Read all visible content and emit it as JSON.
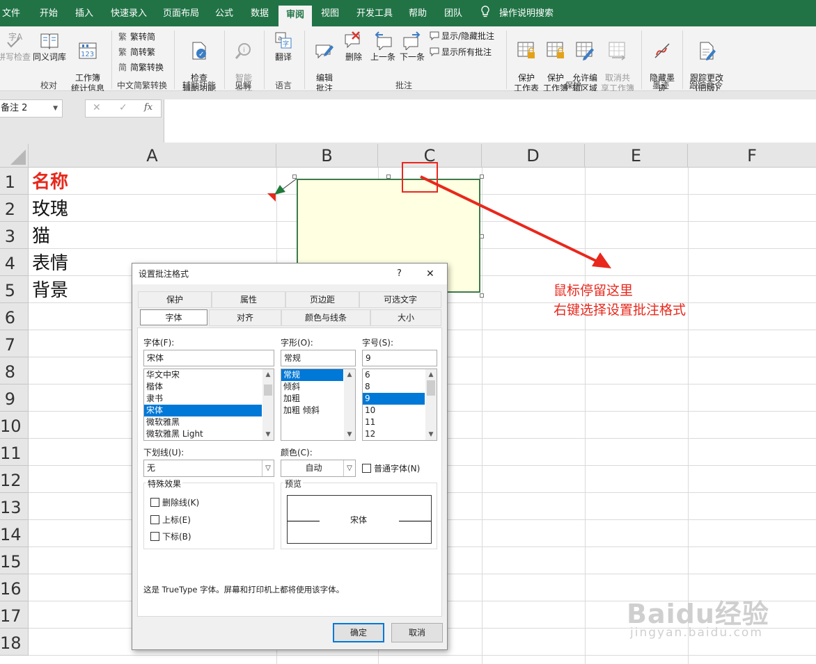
{
  "ribbon": {
    "tabs": [
      "文件",
      "开始",
      "插入",
      "快速录入",
      "页面布局",
      "公式",
      "数据",
      "审阅",
      "视图",
      "开发工具",
      "帮助",
      "团队",
      "操作说明搜索"
    ],
    "active_tab": "审阅",
    "proof": {
      "spell": "拼写检查",
      "thesaurus": "同义词库",
      "stats": "工作簿\n统计信息",
      "label": "校对"
    },
    "chinese": {
      "to_simp": "繁转简",
      "to_trad": "简转繁",
      "convert": "简繁转换",
      "label": "中文简繁转换"
    },
    "access": {
      "check": "检查\n辅助功能",
      "label": "辅助功能"
    },
    "insights": {
      "smart": "智能\n查找",
      "label": "见解"
    },
    "language": {
      "translate": "翻译",
      "label": "语言"
    },
    "comments": {
      "edit": "编辑\n批注",
      "delete": "删除",
      "prev": "上一条",
      "next": "下一条",
      "show_hide": "显示/隐藏批注",
      "show_all": "显示所有批注",
      "label": "批注"
    },
    "protect": {
      "sheet": "保护\n工作表",
      "book": "保护\n工作簿",
      "allow": "允许编\n辑区域",
      "unshare": "取消共\n享工作簿",
      "label": "保护"
    },
    "ink": {
      "hide": "隐藏墨\n迹",
      "label": "墨迹"
    },
    "track": {
      "track": "跟踪更改\n(旧版)",
      "label": "跟踪命令"
    }
  },
  "formula_bar": {
    "name_box": "备注 2",
    "cancel": "✕",
    "enter": "✓",
    "fx": "fx",
    "value": ""
  },
  "sheet": {
    "columns": [
      "A",
      "B",
      "C",
      "D",
      "E",
      "F"
    ],
    "rows": [
      "1",
      "2",
      "3",
      "4",
      "5",
      "6",
      "7",
      "8",
      "9",
      "10",
      "11",
      "12",
      "13",
      "14",
      "15",
      "16",
      "17",
      "18"
    ],
    "cells": {
      "a1": "名称",
      "a2": "玫瑰",
      "a3": "猫",
      "a4": "表情",
      "a5": "背景"
    }
  },
  "annotation": {
    "line1": "鼠标停留这里",
    "line2": "右键选择设置批注格式",
    "color": "#e8281c"
  },
  "dialog": {
    "title": "设置批注格式",
    "help": "?",
    "close": "✕",
    "tabs_row1": [
      "保护",
      "属性",
      "页边距",
      "可选文字"
    ],
    "tabs_row2": [
      "字体",
      "对齐",
      "颜色与线条",
      "大小"
    ],
    "font_label": "字体(F):",
    "font_value": "宋体",
    "font_list": [
      "华文中宋",
      "楷体",
      "隶书",
      "宋体",
      "微软雅黑",
      "微软雅黑 Light"
    ],
    "font_selected": "宋体",
    "style_label": "字形(O):",
    "style_value": "常规",
    "style_list": [
      "常规",
      "倾斜",
      "加粗",
      "加粗 倾斜"
    ],
    "size_label": "字号(S):",
    "size_value": "9",
    "size_list": [
      "6",
      "8",
      "9",
      "10",
      "11",
      "12"
    ],
    "underline_label": "下划线(U):",
    "underline_value": "无",
    "color_label": "颜色(C):",
    "color_value": "自动",
    "normal_font": "普通字体(N)",
    "effects_label": "特殊效果",
    "strike": "删除线(K)",
    "superscript": "上标(E)",
    "subscript": "下标(B)",
    "preview_label": "预览",
    "preview_text": "宋体",
    "note": "这是 TrueType 字体。屏幕和打印机上都将使用该字体。",
    "ok": "确定",
    "cancel": "取消"
  },
  "watermark": {
    "brand": "Baidu经验",
    "url": "jingyan.baidu.com"
  }
}
